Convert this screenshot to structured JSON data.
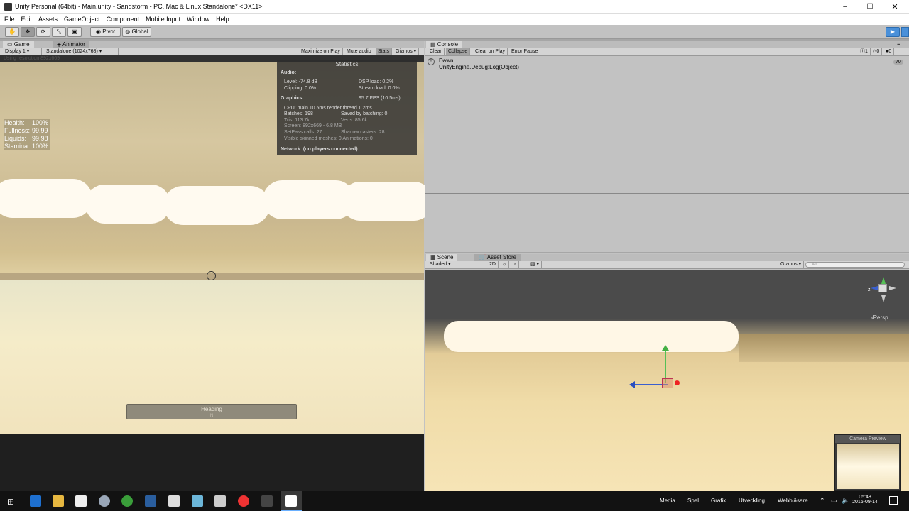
{
  "window": {
    "title": "Unity Personal (64bit) - Main.unity - Sandstorm - PC, Mac & Linux Standalone* <DX11>"
  },
  "menu": [
    "File",
    "Edit",
    "Assets",
    "GameObject",
    "Component",
    "Mobile Input",
    "Window",
    "Help"
  ],
  "toolbar": {
    "pivot": "Pivot",
    "global": "Global"
  },
  "game": {
    "tabs": [
      "Game",
      "Animator"
    ],
    "display": "Display 1",
    "resolution": "Standalone (1024x768)",
    "buttons": [
      "Maximize on Play",
      "Mute audio",
      "Stats",
      "Gizmos"
    ],
    "using_resolution": "Using resolution 892x669",
    "hud": [
      "Health:",
      "100%",
      "Fullness:",
      "99.99",
      "Liquids:",
      "99.98",
      "Stamina:",
      "100%"
    ],
    "heading_label": "Heading",
    "heading_value": "N"
  },
  "stats": {
    "title": "Statistics",
    "audio": "Audio:",
    "level": "Level: -74.8 dB",
    "dsp": "DSP load: 0.2%",
    "clipping": "Clipping: 0.0%",
    "stream": "Stream load: 0.0%",
    "graphics": "Graphics:",
    "fps": "95.7 FPS (10.5ms)",
    "cpu": "CPU: main 10.5ms  render thread 1.2ms",
    "batches": "Batches: 198",
    "saved": "Saved by batching: 0",
    "tris": "Tris: 113.7k",
    "verts": "Verts: 85.6k",
    "screen": "Screen: 892x669 - 6.8 MB",
    "setpass": "SetPass calls: 27",
    "shadow": "Shadow casters: 28",
    "skinned": "Visible skinned meshes: 0  Animations: 0",
    "network": "Network: (no players connected)"
  },
  "console": {
    "tab": "Console",
    "buttons": [
      "Clear",
      "Collapse",
      "Clear on Play",
      "Error Pause"
    ],
    "counts": [
      "1",
      "0",
      "0"
    ],
    "log_line1": "Dawn",
    "log_line2": "UnityEngine.Debug:Log(Object)",
    "log_count": "70"
  },
  "scene": {
    "tabs": [
      "Scene",
      "Asset Store"
    ],
    "shading": "Shaded",
    "mode2d": "2D",
    "gizmos": "Gizmos",
    "search_placeholder": "All",
    "persp": "Persp",
    "axis_z": "z",
    "camera_preview": "Camera Preview"
  },
  "taskbar": {
    "labels": [
      "Media",
      "Spel",
      "Grafik",
      "Utveckling",
      "Webbläsare"
    ],
    "time": "05:48",
    "date": "2016-09-14"
  },
  "colors": {
    "unity_play_blue": "#4a90d9",
    "sand": "#f0dca8",
    "dark_panel": "#313131"
  }
}
